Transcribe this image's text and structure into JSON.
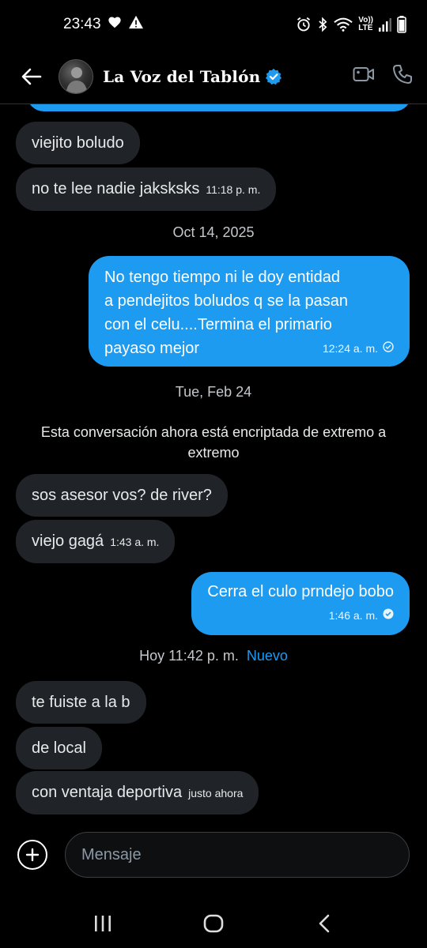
{
  "status_bar": {
    "time": "23:43",
    "icons": [
      "heart-icon",
      "warning-icon",
      "alarm-icon",
      "bluetooth-icon",
      "wifi-icon",
      "volte-icon",
      "signal-icon",
      "battery-icon"
    ],
    "volte_line1": "Vo))",
    "volte_line2": "LTE"
  },
  "header": {
    "contact_name": "La Voz del Tablón",
    "verified": true,
    "accent_color": "#1d9bf0",
    "icons": [
      "back-arrow-icon",
      "video-call-icon",
      "phone-icon"
    ]
  },
  "messages": [
    {
      "id": "m1",
      "direction": "received",
      "text": "viejito boludo",
      "time": ""
    },
    {
      "id": "m2",
      "direction": "received",
      "text": "no te lee nadie jaksksks",
      "time": "11:18 p. m."
    },
    {
      "id": "sep1",
      "type": "date",
      "text": "Oct 14, 2025"
    },
    {
      "id": "m3",
      "direction": "sent",
      "lines": [
        "No tengo tiempo ni le doy entidad",
        "a pendejitos boludos q se la pasan",
        "con el celu....Termina el primario",
        "payaso mejor"
      ],
      "time": "12:24 a. m."
    },
    {
      "id": "sep2",
      "type": "date",
      "text": "Tue, Feb 24"
    },
    {
      "id": "notice",
      "type": "notice",
      "text": "Esta conversación ahora está encriptada de extremo a extremo"
    },
    {
      "id": "m4",
      "direction": "received",
      "text": "sos asesor vos? de river?",
      "time": ""
    },
    {
      "id": "m5",
      "direction": "received",
      "text": "viejo gagá",
      "time": "1:43 a. m."
    },
    {
      "id": "m6",
      "direction": "sent",
      "text": "Cerra el culo prndejo bobo",
      "time": "1:46 a. m."
    },
    {
      "id": "sep3",
      "type": "date",
      "text": "Hoy 11:42 p. m.",
      "badge": "Nuevo"
    },
    {
      "id": "m7",
      "direction": "received",
      "text": "te fuiste a la b",
      "time": ""
    },
    {
      "id": "m8",
      "direction": "received",
      "text": "de local",
      "time": ""
    },
    {
      "id": "m9",
      "direction": "received",
      "text": "con ventaja deportiva",
      "time": "justo ahora"
    }
  ],
  "composer": {
    "placeholder": "Mensaje",
    "icons": [
      "add-icon"
    ]
  },
  "nav_bar": {
    "icons": [
      "recent-apps-icon",
      "home-icon",
      "back-icon"
    ]
  },
  "colors": {
    "background": "#000000",
    "received_bubble": "#202327",
    "sent_bubble": "#1d9bf0"
  }
}
